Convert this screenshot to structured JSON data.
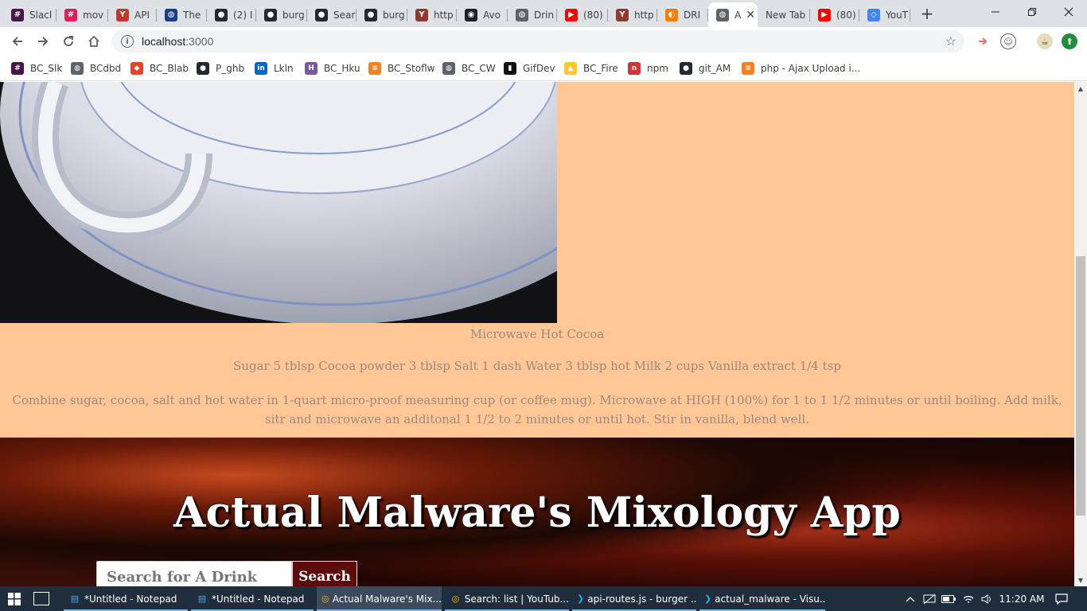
{
  "browser": {
    "tabs": [
      {
        "label": "Slacl",
        "icon": "slack-icon",
        "color": "#4a154b"
      },
      {
        "label": "mov",
        "icon": "slack-icon",
        "color": "#e01e5a"
      },
      {
        "label": "API",
        "icon": "cocktail-icon",
        "color": "#c0392b"
      },
      {
        "label": "The",
        "icon": "globe-icon",
        "color": "#1a3e8c"
      },
      {
        "label": "(2) I",
        "icon": "github-icon",
        "color": "#24292e"
      },
      {
        "label": "burg",
        "icon": "github-icon",
        "color": "#24292e"
      },
      {
        "label": "Sear",
        "icon": "github-icon",
        "color": "#24292e"
      },
      {
        "label": "burg",
        "icon": "github-icon",
        "color": "#24292e"
      },
      {
        "label": "http",
        "icon": "cocktail-icon",
        "color": "#8e3b2f"
      },
      {
        "label": "Avo",
        "icon": "record-icon",
        "color": "#202124"
      },
      {
        "label": "Drin",
        "icon": "globe-icon",
        "color": "#5f6368"
      },
      {
        "label": "(80)",
        "icon": "youtube-icon",
        "color": "#ff0000"
      },
      {
        "label": "http",
        "icon": "cocktail-icon",
        "color": "#8e3b2f"
      },
      {
        "label": "DRI",
        "icon": "drink-icon",
        "color": "#f57c00"
      },
      {
        "label": "A",
        "icon": "globe-icon",
        "color": "#5f6368",
        "active": true
      },
      {
        "label": "New Tab",
        "icon": "",
        "color": ""
      },
      {
        "label": "(80)",
        "icon": "youtube-icon",
        "color": "#ff0000"
      },
      {
        "label": "YouT",
        "icon": "code-icon",
        "color": "#4285f4"
      }
    ],
    "new_tab_glyph": "+",
    "close_glyph": "✕",
    "url_host": "localhost",
    "url_port": ":3000",
    "bookmarks": [
      {
        "label": "BC_Slk",
        "icon": "slack-icon",
        "color": "#4a154b"
      },
      {
        "label": "BCdbd",
        "icon": "globe-icon",
        "color": "#5f6368"
      },
      {
        "label": "BC_Blab",
        "icon": "gitlab-icon",
        "color": "#e24329"
      },
      {
        "label": "P_ghb",
        "icon": "github-icon",
        "color": "#24292e"
      },
      {
        "label": "Lkln",
        "icon": "linkedin-icon",
        "color": "#0a66c2"
      },
      {
        "label": "BC_Hku",
        "icon": "heroku-icon",
        "color": "#79589f"
      },
      {
        "label": "BC_Stoflw",
        "icon": "stackoverflow-icon",
        "color": "#f48024"
      },
      {
        "label": "BC_CW",
        "icon": "globe-icon",
        "color": "#5f6368"
      },
      {
        "label": "GifDev",
        "icon": "giphy-icon",
        "color": "#121212"
      },
      {
        "label": "BC_Fire",
        "icon": "firebase-icon",
        "color": "#ffca28"
      },
      {
        "label": "npm",
        "icon": "npm-icon",
        "color": "#cb3837"
      },
      {
        "label": "git_AM",
        "icon": "github-icon",
        "color": "#24292e"
      },
      {
        "label": "php - Ajax Upload i...",
        "icon": "stackoverflow-icon",
        "color": "#f48024"
      }
    ]
  },
  "page": {
    "recipe": {
      "name": "Microwave Hot Cocoa",
      "ingredients": "Sugar 5 tblsp Cocoa powder 3 tblsp Salt 1 dash Water 3 tblsp hot Milk 2 cups Vanilla extract 1/4 tsp",
      "instructions": "Combine sugar, cocoa, salt and hot water in 1-quart micro-proof measuring cup (or coffee mug). Microwave at HIGH (100%) for 1 to 1 1/2 minutes or until boiling. Add milk, sitr and microwave an additonal 1 1/2 to 2 minutes or until hot. Stir in vanilla, blend well."
    },
    "hero_title": "Actual Malware's Mixology App",
    "search_placeholder": "Search for A Drink",
    "search_button": "Search"
  },
  "taskbar": {
    "items": [
      {
        "label": "*Untitled - Notepad",
        "icon": "notepad-icon"
      },
      {
        "label": "*Untitled - Notepad",
        "icon": "notepad-icon"
      },
      {
        "label": "Actual Malware's Mix...",
        "icon": "chrome-icon",
        "active": true
      },
      {
        "label": "Search: list | YouTub...",
        "icon": "chrome-icon"
      },
      {
        "label": "api-routes.js - burger ...",
        "icon": "vscode-icon"
      },
      {
        "label": "actual_malware - Visu...",
        "icon": "vscode-icon"
      }
    ],
    "clock": "11:20 AM"
  },
  "colors": {
    "page_bg": "#ffc796",
    "recipe_text": "#9a8a80",
    "search_button_bg": "#5c0c0a",
    "taskbar_bg": "#1f2d3d"
  }
}
